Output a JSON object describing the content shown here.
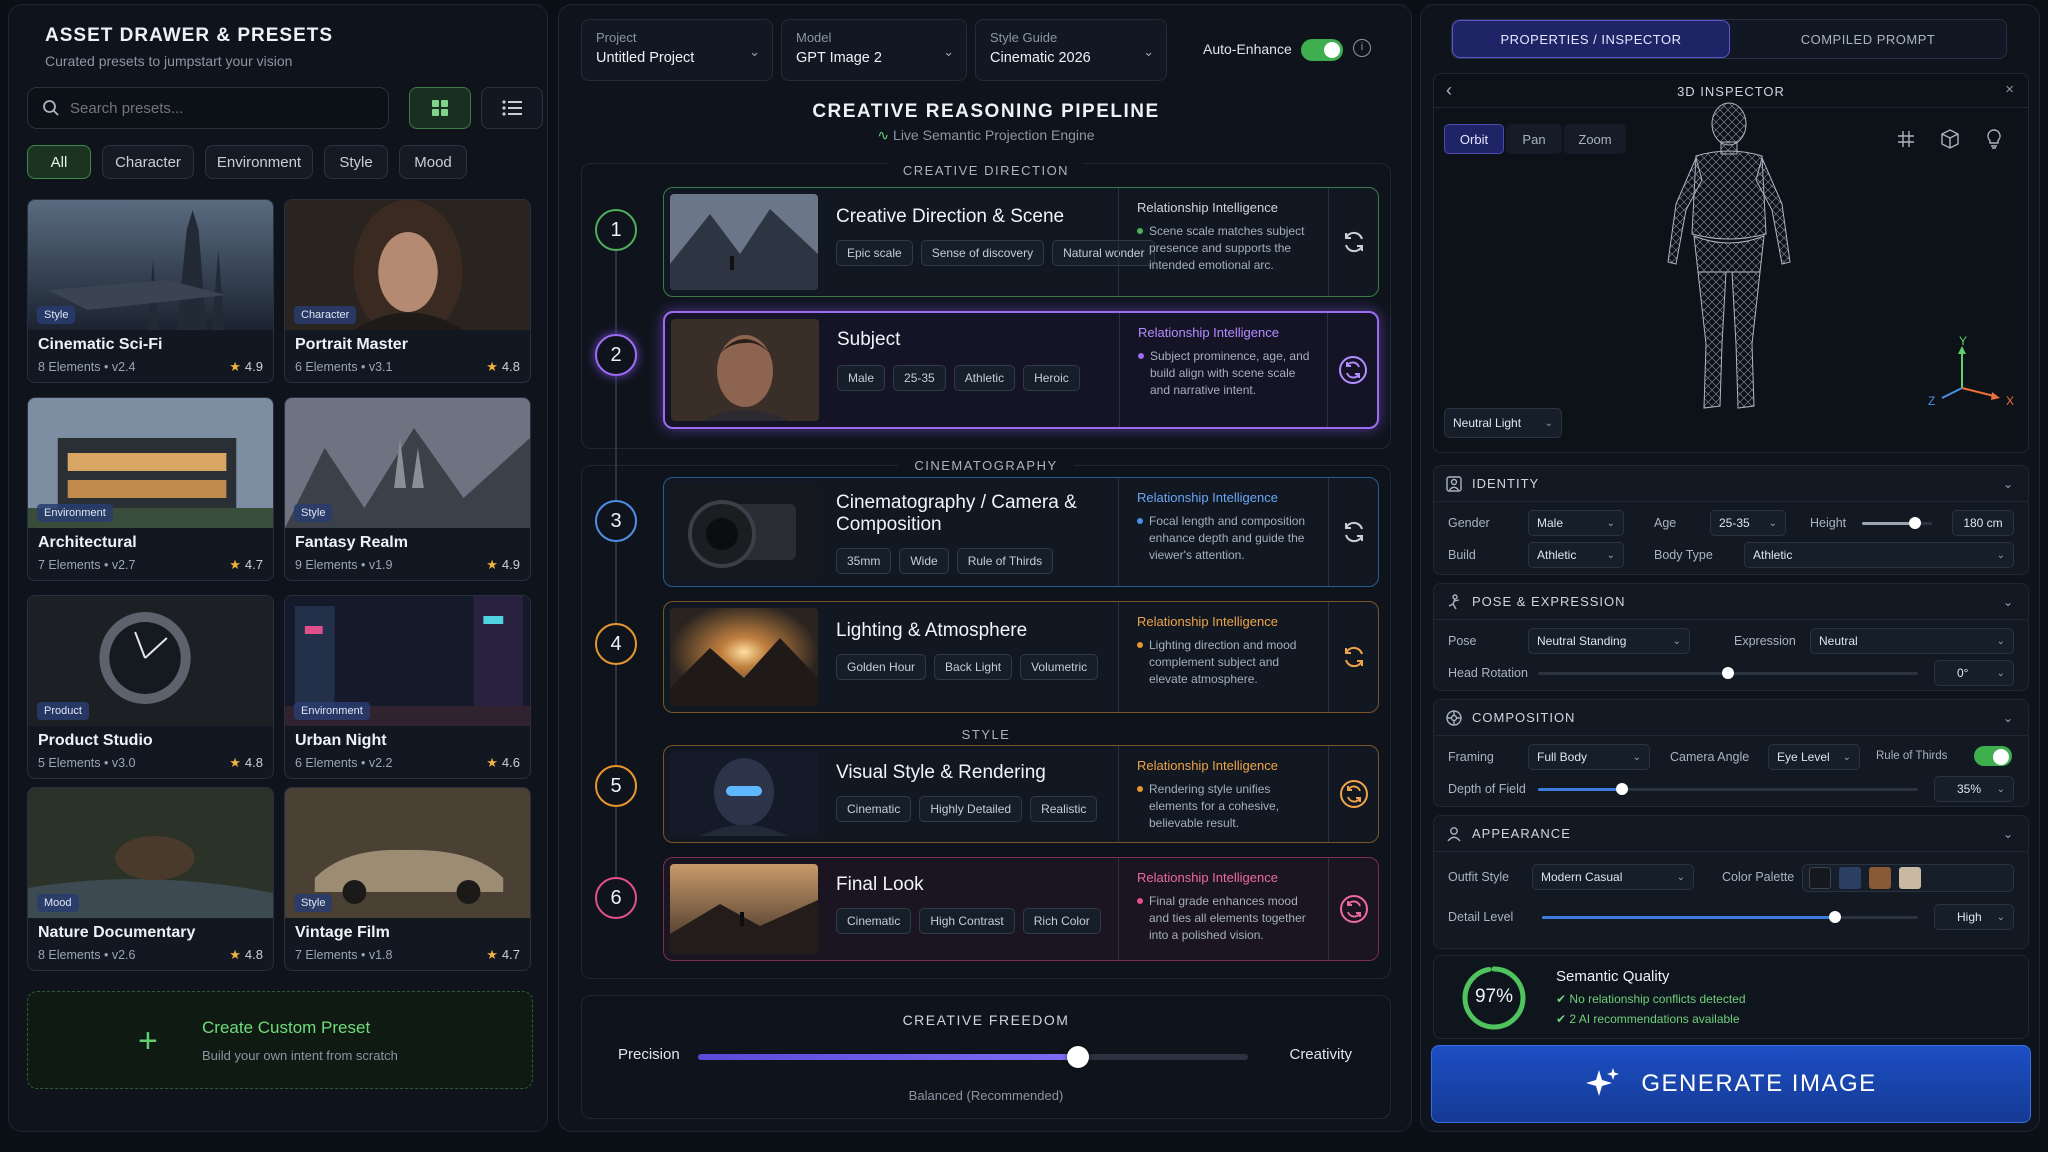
{
  "left": {
    "title": "ASSET DRAWER & PRESETS",
    "subtitle": "Curated presets to jumpstart your vision",
    "search_placeholder": "Search presets...",
    "filters": [
      "All",
      "Character",
      "Environment",
      "Style",
      "Mood"
    ],
    "active_filter": "All",
    "presets": [
      {
        "name": "Cinematic Sci-Fi",
        "badge": "Style",
        "elements": "8 Elements",
        "version": "v2.4",
        "rating": "4.9"
      },
      {
        "name": "Portrait Master",
        "badge": "Character",
        "elements": "6 Elements",
        "version": "v3.1",
        "rating": "4.8"
      },
      {
        "name": "Architectural",
        "badge": "Environment",
        "elements": "7 Elements",
        "version": "v2.7",
        "rating": "4.7"
      },
      {
        "name": "Fantasy Realm",
        "badge": "Style",
        "elements": "9 Elements",
        "version": "v1.9",
        "rating": "4.9"
      },
      {
        "name": "Product Studio",
        "badge": "Product",
        "elements": "5 Elements",
        "version": "v3.0",
        "rating": "4.8"
      },
      {
        "name": "Urban Night",
        "badge": "Environment",
        "elements": "6 Elements",
        "version": "v2.2",
        "rating": "4.6"
      },
      {
        "name": "Nature Documentary",
        "badge": "Mood",
        "elements": "8 Elements",
        "version": "v2.6",
        "rating": "4.8"
      },
      {
        "name": "Vintage Film",
        "badge": "Style",
        "elements": "7 Elements",
        "version": "v1.8",
        "rating": "4.7"
      }
    ],
    "create": {
      "title": "Create Custom Preset",
      "subtitle": "Build your own intent from scratch"
    }
  },
  "center": {
    "project": {
      "label": "Project",
      "value": "Untitled Project"
    },
    "model": {
      "label": "Model",
      "value": "GPT Image 2"
    },
    "style_guide": {
      "label": "Style Guide",
      "value": "Cinematic 2026"
    },
    "auto_enhance": {
      "label": "Auto-Enhance",
      "on": true
    },
    "pipeline_title": "CREATIVE REASONING PIPELINE",
    "pipeline_subtitle": "Live Semantic Projection Engine",
    "sections": {
      "creative_direction": "CREATIVE DIRECTION",
      "cinematography": "CINEMATOGRAPHY",
      "style": "STYLE"
    },
    "steps": [
      {
        "n": "1",
        "title": "Creative Direction & Scene",
        "tags": [
          "Epic scale",
          "Sense of discovery",
          "Natural wonder"
        ],
        "ri_title": "Relationship Intelligence",
        "ri_text": "Scene scale matches subject presence and supports the intended emotional arc.",
        "color": "#4fae5a"
      },
      {
        "n": "2",
        "title": "Subject",
        "tags": [
          "Male",
          "25-35",
          "Athletic",
          "Heroic"
        ],
        "ri_title": "Relationship Intelligence",
        "ri_text": "Subject prominence, age, and build align with scene scale and narrative intent.",
        "color": "#9b6cf0"
      },
      {
        "n": "3",
        "title": "Cinematography / Camera & Composition",
        "tags": [
          "35mm",
          "Wide",
          "Rule of Thirds"
        ],
        "ri_title": "Relationship Intelligence",
        "ri_text": "Focal length and composition enhance depth and guide the viewer's attention.",
        "color": "#4d8fe6"
      },
      {
        "n": "4",
        "title": "Lighting & Atmosphere",
        "tags": [
          "Golden Hour",
          "Back Light",
          "Volumetric"
        ],
        "ri_title": "Relationship Intelligence",
        "ri_text": "Lighting direction and mood complement subject and elevate atmosphere.",
        "color": "#e7962f"
      },
      {
        "n": "5",
        "title": "Visual Style & Rendering",
        "tags": [
          "Cinematic",
          "Highly Detailed",
          "Realistic"
        ],
        "ri_title": "Relationship Intelligence",
        "ri_text": "Rendering style unifies elements for a cohesive, believable result.",
        "color": "#e7962f"
      },
      {
        "n": "6",
        "title": "Final Look",
        "tags": [
          "Cinematic",
          "High Contrast",
          "Rich Color"
        ],
        "ri_title": "Relationship Intelligence",
        "ri_text": "Final grade enhances mood and ties all elements together into a polished vision.",
        "color": "#e0508a"
      }
    ],
    "freedom": {
      "title": "CREATIVE FREEDOM",
      "left": "Precision",
      "right": "Creativity",
      "value_label": "Balanced (Recommended)",
      "value": 0.69
    }
  },
  "right": {
    "tabs": [
      "PROPERTIES / INSPECTOR",
      "COMPILED PROMPT"
    ],
    "inspector_title": "3D INSPECTOR",
    "view_modes": [
      "Orbit",
      "Pan",
      "Zoom"
    ],
    "active_mode": "Orbit",
    "light_select": "Neutral Light",
    "axes": {
      "y": "Y",
      "x": "X",
      "z": "Z"
    },
    "identity": {
      "title": "IDENTITY",
      "gender_label": "Gender",
      "gender": "Male",
      "age_label": "Age",
      "age": "25-35",
      "height_label": "Height",
      "height": "180 cm",
      "height_level": 0.75,
      "build_label": "Build",
      "build": "Athletic",
      "body_type_label": "Body Type",
      "body_type": "Athletic"
    },
    "pose": {
      "title": "POSE & EXPRESSION",
      "pose_label": "Pose",
      "pose": "Neutral Standing",
      "expression_label": "Expression",
      "expression": "Neutral",
      "head_label": "Head Rotation",
      "head": "0°",
      "head_level": 0.5
    },
    "composition": {
      "title": "COMPOSITION",
      "framing_label": "Framing",
      "framing": "Full Body",
      "angle_label": "Camera Angle",
      "angle": "Eye Level",
      "thirds_label": "Rule of Thirds",
      "thirds_on": true,
      "dof_label": "Depth of Field",
      "dof": "35%",
      "dof_level": 0.22
    },
    "appearance": {
      "title": "APPEARANCE",
      "outfit_label": "Outfit Style",
      "outfit": "Modern Casual",
      "palette_label": "Color Palette",
      "palette": [
        "#15181d",
        "#2b3f63",
        "#8a5a36",
        "#c9b9a3"
      ],
      "detail_label": "Detail Level",
      "detail": "High",
      "detail_level": 0.78
    },
    "quality": {
      "percent": "97%",
      "value": 0.97,
      "title": "Semantic Quality",
      "line1": "No relationship conflicts detected",
      "line2": "2 AI recommendations available"
    },
    "generate": "GENERATE IMAGE"
  }
}
